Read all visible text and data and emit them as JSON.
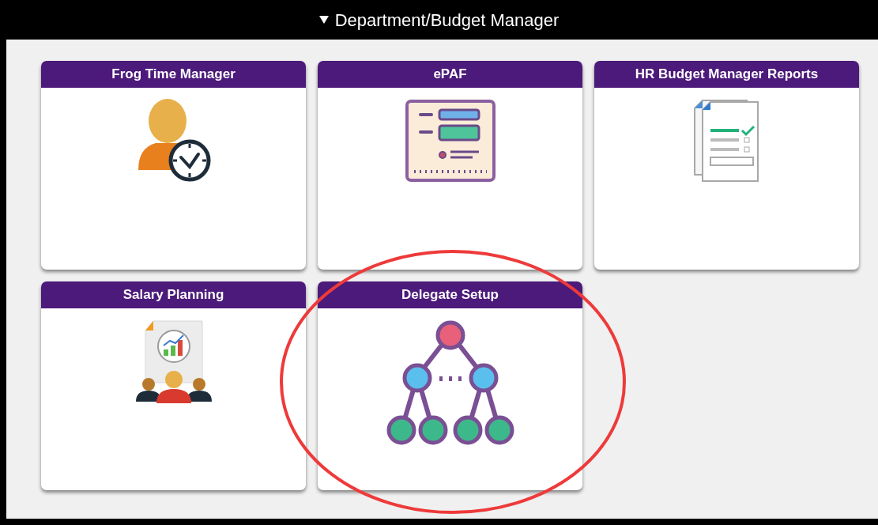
{
  "section": {
    "title": "Department/Budget Manager",
    "expanded": true
  },
  "tiles": [
    {
      "title": "Frog Time Manager",
      "kind": "time",
      "circled": false
    },
    {
      "title": "ePAF",
      "kind": "form",
      "circled": false
    },
    {
      "title": "HR Budget Manager Reports",
      "kind": "report",
      "circled": false
    },
    {
      "title": "Salary Planning",
      "kind": "planning",
      "circled": false
    },
    {
      "title": "Delegate Setup",
      "kind": "hierarchy",
      "circled": true
    }
  ]
}
